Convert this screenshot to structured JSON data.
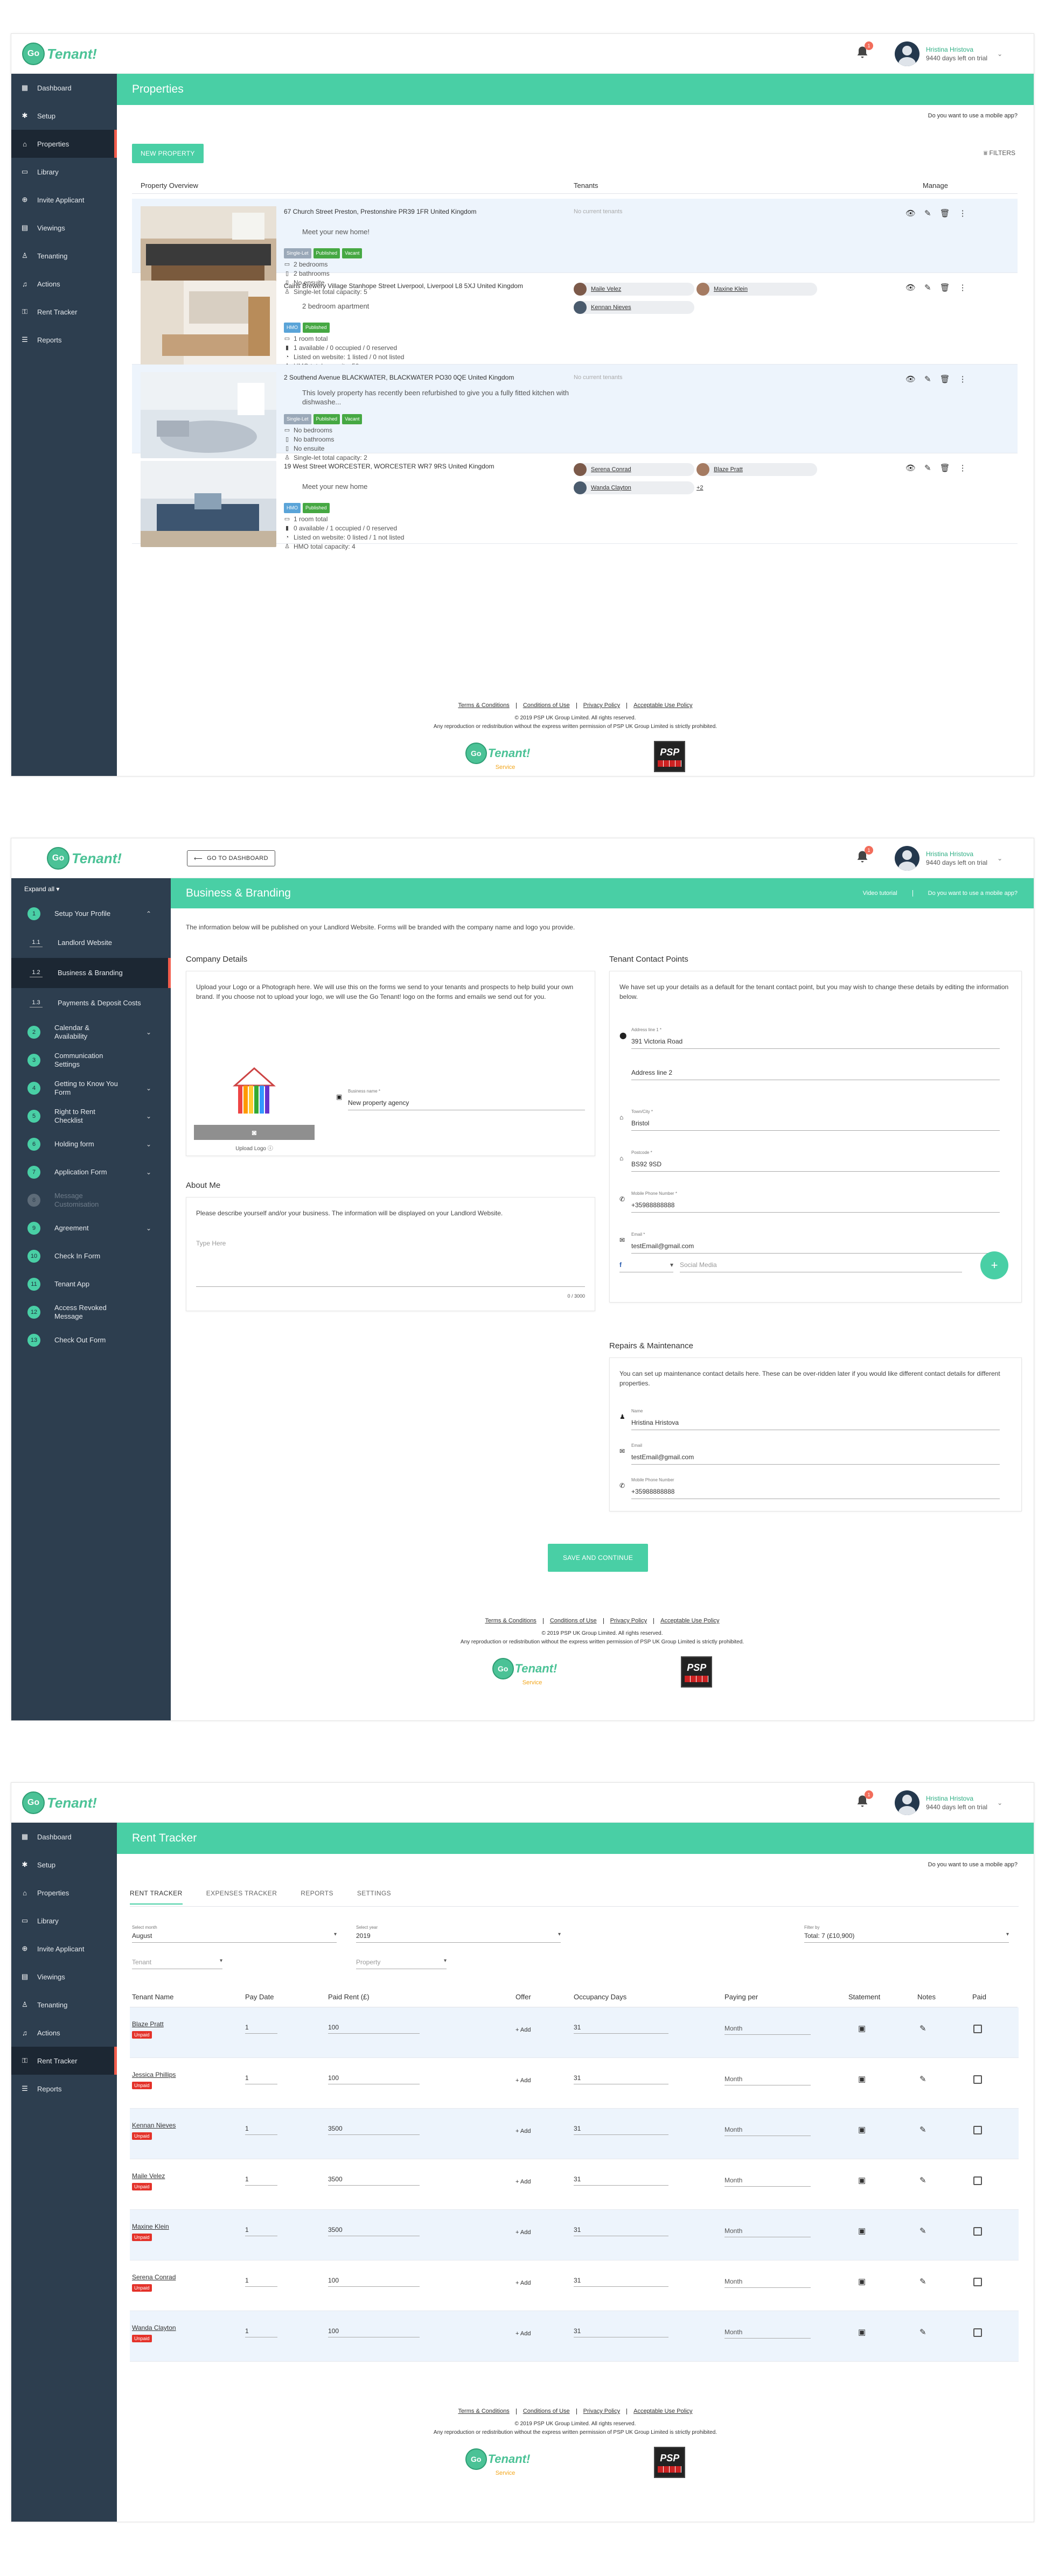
{
  "brand": {
    "go": "Go",
    "word": "Tenant!",
    "service": "Service",
    "psp": "PSP"
  },
  "user": {
    "name": "Hristina Hristova",
    "trial": "9440 days left on trial",
    "notifications": "1"
  },
  "colors": {
    "accent": "#49cfa5",
    "sidebar": "#2d3e4f",
    "unpaid": "#e4322a",
    "active_marker": "#f25c4c"
  },
  "nav": [
    {
      "label": "Dashboard",
      "icon": "dashboard-icon",
      "glyph": "▦"
    },
    {
      "label": "Setup",
      "icon": "gear-icon",
      "glyph": "✱"
    },
    {
      "label": "Properties",
      "icon": "home-icon",
      "glyph": "⌂"
    },
    {
      "label": "Library",
      "icon": "folder-icon",
      "glyph": "▭"
    },
    {
      "label": "Invite Applicant",
      "icon": "add-user-icon",
      "glyph": "⊕"
    },
    {
      "label": "Viewings",
      "icon": "calendar-icon",
      "glyph": "▤"
    },
    {
      "label": "Tenanting",
      "icon": "person-icon",
      "glyph": "♙"
    },
    {
      "label": "Actions",
      "icon": "bell-icon",
      "glyph": "♫"
    },
    {
      "label": "Rent Tracker",
      "icon": "key-icon",
      "glyph": "⚿"
    },
    {
      "label": "Reports",
      "icon": "list-icon",
      "glyph": "☰"
    }
  ],
  "mobile_question": "Do you want to use a mobile app?",
  "properties": {
    "title": "Properties",
    "new_button": "NEW PROPERTY",
    "filters": "FILTERS",
    "headers": {
      "overview": "Property Overview",
      "tenants": "Tenants",
      "manage": "Manage"
    },
    "no_tenants": "No current tenants",
    "rows": [
      {
        "address": "67 Church Street Preston, Prestonshire PR39 1FR United Kingdom",
        "desc": "Meet your new home!",
        "tags": [
          {
            "t": "Single-Let",
            "c": "grey"
          },
          {
            "t": "Published",
            "c": "green"
          },
          {
            "t": "Vacant",
            "c": "green"
          }
        ],
        "features": [
          {
            "i": "▭",
            "t": "2 bedrooms"
          },
          {
            "i": "▯",
            "t": "2 bathrooms"
          },
          {
            "i": "▯",
            "t": "No ensuite"
          },
          {
            "i": "♙",
            "t": "Single-let total capacity: 5"
          }
        ],
        "tenants": []
      },
      {
        "address": "Cains Brewery Village Stanhope Street Liverpool, Liverpool L8 5XJ United Kingdom",
        "desc": "2 bedroom apartment",
        "tags": [
          {
            "t": "HMO",
            "c": "blue"
          },
          {
            "t": "Published",
            "c": "green"
          }
        ],
        "features": [
          {
            "i": "▭",
            "t": "1 room total"
          },
          {
            "i": "▮",
            "t": "1 available / 0 occupied / 0 reserved"
          },
          {
            "i": "◔",
            "t": "Listed on website: 1 listed / 0 not listed"
          },
          {
            "i": "♙",
            "t": "HMO total capacity: 50"
          }
        ],
        "tenants": [
          "Maile Velez",
          "Maxine Klein",
          "Kennan Nieves"
        ]
      },
      {
        "address": "2 Southend Avenue BLACKWATER, BLACKWATER PO30 0QE United Kingdom",
        "desc": "This lovely property has recently been refurbished to give you a fully fitted kitchen with dishwashe...",
        "tags": [
          {
            "t": "Single-Let",
            "c": "grey"
          },
          {
            "t": "Published",
            "c": "green"
          },
          {
            "t": "Vacant",
            "c": "green"
          }
        ],
        "features": [
          {
            "i": "▭",
            "t": "No bedrooms"
          },
          {
            "i": "▯",
            "t": "No bathrooms"
          },
          {
            "i": "▯",
            "t": "No ensuite"
          },
          {
            "i": "♙",
            "t": "Single-let total capacity: 2"
          }
        ],
        "tenants": []
      },
      {
        "address": "19 West Street WORCESTER, WORCESTER WR7 9RS United Kingdom",
        "desc": "Meet your new home",
        "tags": [
          {
            "t": "HMO",
            "c": "blue"
          },
          {
            "t": "Published",
            "c": "green"
          }
        ],
        "features": [
          {
            "i": "▭",
            "t": "1 room total"
          },
          {
            "i": "▮",
            "t": "0 available / 1 occupied / 0 reserved"
          },
          {
            "i": "◔",
            "t": "Listed on website: 0 listed / 1 not listed"
          },
          {
            "i": "♙",
            "t": "HMO total capacity: 4"
          }
        ],
        "tenants": [
          "Serena Conrad",
          "Blaze Pratt",
          "Wanda Clayton"
        ],
        "more": "+2"
      }
    ]
  },
  "footer": {
    "links": [
      "Terms & Conditions",
      "Conditions of Use",
      "Privacy Policy",
      "Acceptable Use Policy"
    ],
    "copy1": "© 2019 PSP UK Group Limited. All rights reserved.",
    "copy2": "Any reproduction or redistribution without the express written permission of PSP UK Group Limited is strictly prohibited."
  },
  "branding": {
    "dashboard_button": "GO TO DASHBOARD",
    "expand_all": "Expand all",
    "title": "Business & Branding",
    "video": "Video tutorial",
    "intro": "The information below will be published on your Landlord Website. Forms will be branded with the company name and logo you provide.",
    "company_title": "Company Details",
    "company_text": "Upload your Logo or a Photograph here. We will use this on the forms we send to your tenants and prospects to help build your own brand. If you choose not to upload your logo, we will use the Go Tenant! logo on the forms and emails we send out for you.",
    "upload_label": "Upload Logo",
    "business_label": "Business name *",
    "business_value": "New property agency",
    "about_title": "About Me",
    "about_text": "Please describe yourself and/or your business. The information will be displayed on your Landlord Website.",
    "type_here": "Type Here",
    "counter": "0 / 3000",
    "contact_title": "Tenant Contact Points",
    "contact_text": "We have set up your details as a default for the tenant contact point, but you may wish to change these details by editing the information below.",
    "contact_fields": [
      {
        "label": "Address line 1 *",
        "value": "391 Victoria Road",
        "icon": "pin-icon",
        "glyph": "⬤"
      },
      {
        "label": "",
        "value": "Address line 2",
        "icon": "",
        "glyph": "",
        "ph": true
      },
      {
        "label": "Town/City *",
        "value": "Bristol",
        "icon": "house-icon",
        "glyph": "⌂"
      },
      {
        "label": "Postcode *",
        "value": "BS92 9SD",
        "icon": "house-icon",
        "glyph": "⌂"
      },
      {
        "label": "Mobile Phone Number *",
        "value": "+35988888888",
        "icon": "phone-icon",
        "glyph": "✆"
      },
      {
        "label": "Email *",
        "value": "testEmail@gmail.com",
        "icon": "mail-icon",
        "glyph": "✉"
      }
    ],
    "social_select": "f",
    "social_placeholder": "Social Media",
    "repairs_title": "Repairs & Maintenance",
    "repairs_text": "You can set up maintenance contact details here. These can be over-ridden later if you would like different contact details for different properties.",
    "repairs_fields": [
      {
        "label": "Name",
        "value": "Hristina Hristova",
        "icon": "person-icon",
        "glyph": "♟"
      },
      {
        "label": "Email",
        "value": "testEmail@gmail.com",
        "icon": "mail-icon",
        "glyph": "✉"
      },
      {
        "label": "Mobile Phone Number",
        "value": "+35988888888",
        "icon": "phone-icon",
        "glyph": "✆"
      }
    ],
    "save_button": "SAVE AND CONTINUE",
    "steps": [
      {
        "n": "1",
        "label": "Setup Your Profile",
        "arrow": "⌃"
      },
      {
        "sub": "1.1",
        "label": "Landlord Website"
      },
      {
        "sub": "1.2",
        "label": "Business & Branding",
        "active": true
      },
      {
        "sub": "1.3",
        "label": "Payments & Deposit Costs"
      },
      {
        "n": "2",
        "label": "Calendar & Availability",
        "arrow": "⌄"
      },
      {
        "n": "3",
        "label": "Communication Settings"
      },
      {
        "n": "4",
        "label": "Getting to Know You Form",
        "arrow": "⌄"
      },
      {
        "n": "5",
        "label": "Right to Rent Checklist",
        "arrow": "⌄"
      },
      {
        "n": "6",
        "label": "Holding form",
        "arrow": "⌄"
      },
      {
        "n": "7",
        "label": "Application Form",
        "arrow": "⌄"
      },
      {
        "n": "8",
        "label": "Message Customisation",
        "dim": true
      },
      {
        "n": "9",
        "label": "Agreement",
        "arrow": "⌄"
      },
      {
        "n": "10",
        "label": "Check In Form"
      },
      {
        "n": "11",
        "label": "Tenant App"
      },
      {
        "n": "12",
        "label": "Access Revoked Message"
      },
      {
        "n": "13",
        "label": "Check Out Form"
      }
    ]
  },
  "rent": {
    "title": "Rent Tracker",
    "tabs": [
      "RENT TRACKER",
      "EXPENSES TRACKER",
      "REPORTS",
      "SETTINGS"
    ],
    "month_label": "Select month",
    "month": "August",
    "year_label": "Select year",
    "year": "2019",
    "filter_label": "Filter by",
    "filter": "Total: 7 (£10,900)",
    "tenant_ph": "Tenant",
    "property_ph": "Property",
    "headers": [
      "Tenant Name",
      "Pay Date",
      "Paid Rent (£)",
      "Offer",
      "Occupancy Days",
      "Paying per",
      "Statement",
      "Notes",
      "Paid"
    ],
    "unpaid": "Unpaid",
    "add": "+ Add",
    "rows": [
      {
        "name": "Blaze Pratt",
        "day": "1",
        "rent": "100",
        "occ": "31",
        "per": "Month"
      },
      {
        "name": "Jessica Phillips",
        "day": "1",
        "rent": "100",
        "occ": "31",
        "per": "Month"
      },
      {
        "name": "Kennan Nieves",
        "day": "1",
        "rent": "3500",
        "occ": "31",
        "per": "Month"
      },
      {
        "name": "Maile Velez",
        "day": "1",
        "rent": "3500",
        "occ": "31",
        "per": "Month"
      },
      {
        "name": "Maxine Klein",
        "day": "1",
        "rent": "3500",
        "occ": "31",
        "per": "Month"
      },
      {
        "name": "Serena Conrad",
        "day": "1",
        "rent": "100",
        "occ": "31",
        "per": "Month"
      },
      {
        "name": "Wanda Clayton",
        "day": "1",
        "rent": "100",
        "occ": "31",
        "per": "Month"
      }
    ]
  }
}
